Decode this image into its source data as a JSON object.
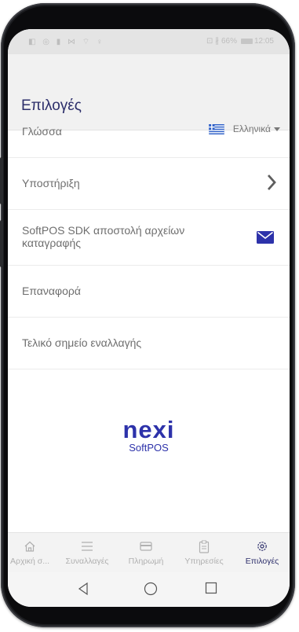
{
  "statusbar": {
    "left_icons": "◧ ◎ ▮ ⋈ ⌔ ♀",
    "right_text": "⊡ ∦ 66%",
    "time": "12:05"
  },
  "header": {
    "title": "Επιλογές"
  },
  "settings": {
    "language_label": "Γλώσσα",
    "language_value": "Ελληνικά",
    "support_label": "Υποστήριξη",
    "sdk_logs_label": "SoftPOS SDK αποστολή αρχείων καταγραφής",
    "reset_label": "Επαναφορά",
    "endpoint_label": "Τελικό σημείο εναλλαγής"
  },
  "brand": {
    "logo_text": "nexi",
    "sub_text": "SoftPOS",
    "color": "#2d32aa"
  },
  "bottom_nav": [
    {
      "label": "Αρχική σ...",
      "icon": "home-icon"
    },
    {
      "label": "Συναλλαγές",
      "icon": "list-icon"
    },
    {
      "label": "Πληρωμή",
      "icon": "card-icon"
    },
    {
      "label": "Υπηρεσίες",
      "icon": "clipboard-icon"
    },
    {
      "label": "Επιλογές",
      "icon": "gear-icon",
      "active": true
    }
  ],
  "colors": {
    "accent": "#2d2f6b",
    "icon_blue": "#2d32aa",
    "muted": "#b0b0b0"
  }
}
